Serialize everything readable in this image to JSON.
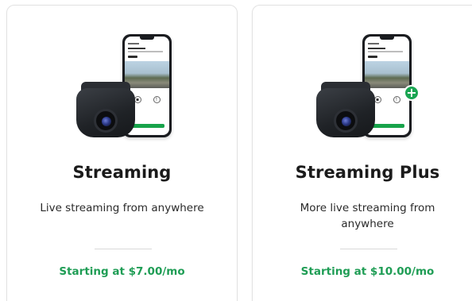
{
  "plans": [
    {
      "title": "Streaming",
      "description": "Live streaming from anywhere",
      "price": "Starting at $7.00/mo"
    },
    {
      "title": "Streaming Plus",
      "description": "More live streaming from anywhere",
      "price": "Starting at $10.00/mo"
    }
  ],
  "colors": {
    "price_green": "#1f9d55",
    "badge_green": "#1aa552",
    "card_border": "#e2e2e2"
  },
  "icons": {
    "plus_badge": "+"
  }
}
